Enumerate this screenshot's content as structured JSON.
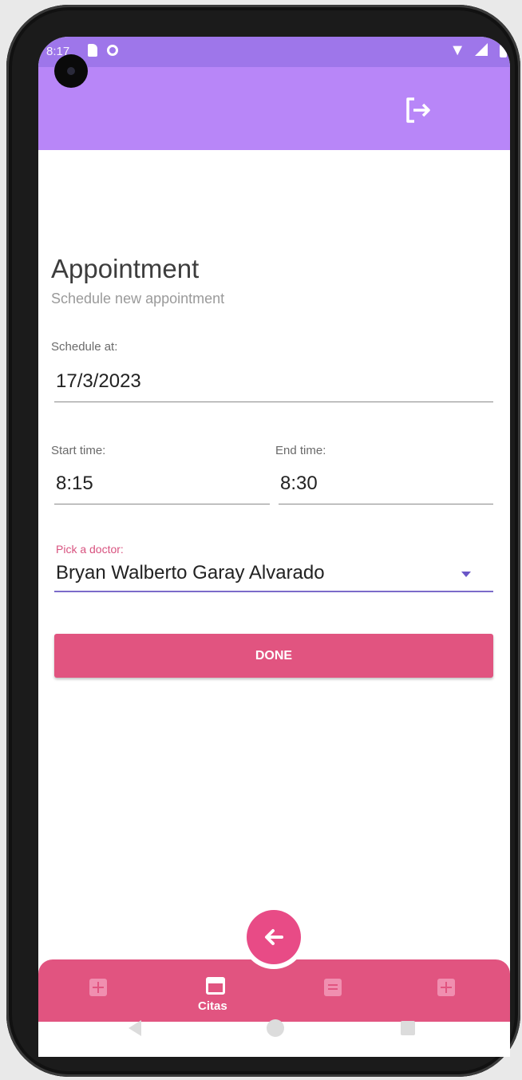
{
  "status_bar": {
    "time": "8:17"
  },
  "appbar": {
    "logout_icon": "logout-icon"
  },
  "form": {
    "title": "Appointment",
    "subtitle": "Schedule new appointment",
    "schedule_label": "Schedule at:",
    "schedule_value": "17/3/2023",
    "start_label": "Start time:",
    "start_value": "8:15",
    "end_label": "End time:",
    "end_value": "8:30",
    "doctor_label": "Pick a doctor:",
    "doctor_value": "Bryan Walberto Garay Alvarado",
    "done_label": "DONE"
  },
  "bottom_nav": {
    "items": [
      {
        "icon": "calculator-icon",
        "label": ""
      },
      {
        "icon": "calendar-edit-icon",
        "label": "Citas"
      },
      {
        "icon": "document-icon",
        "label": ""
      },
      {
        "icon": "calculator-icon",
        "label": ""
      }
    ],
    "fab_icon": "arrow-left-icon",
    "active_index": 1
  },
  "colors": {
    "appbar": "#b886f8",
    "status_bar": "#9e76ea",
    "accent": "#e15480",
    "picker_underline": "#7b6bc9"
  }
}
